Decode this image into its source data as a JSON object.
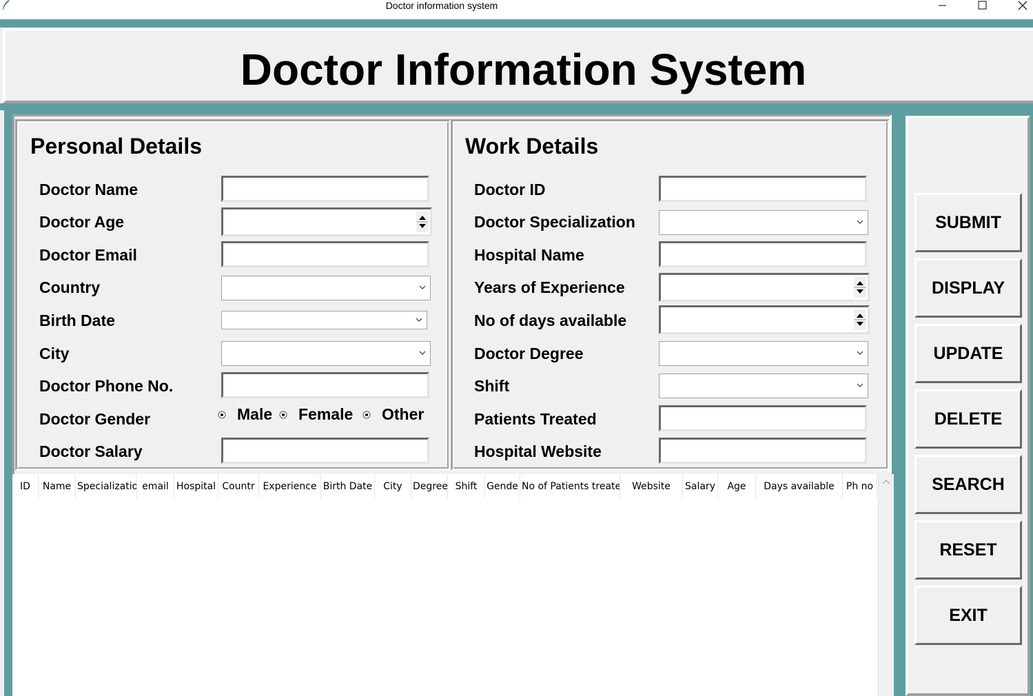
{
  "window": {
    "title": "Doctor information system",
    "controls": [
      "minimize",
      "maximize",
      "close"
    ]
  },
  "header": {
    "title": "Doctor Information System"
  },
  "personal": {
    "title": "Personal Details",
    "fields": [
      {
        "label": "Doctor Name",
        "type": "entry",
        "value": ""
      },
      {
        "label": "Doctor Age",
        "type": "spinbox",
        "value": ""
      },
      {
        "label": "Doctor Email",
        "type": "entry",
        "value": ""
      },
      {
        "label": "Country",
        "type": "combobox",
        "value": ""
      },
      {
        "label": "Birth Date",
        "type": "combobox",
        "value": ""
      },
      {
        "label": "City",
        "type": "combobox",
        "value": ""
      },
      {
        "label": "Doctor Phone No.",
        "type": "entry",
        "value": ""
      },
      {
        "label": "Doctor Gender",
        "type": "radio",
        "options": [
          "Male",
          "Female",
          "Other"
        ]
      },
      {
        "label": "Doctor Salary",
        "type": "entry",
        "value": ""
      }
    ]
  },
  "work": {
    "title": "Work Details",
    "fields": [
      {
        "label": "Doctor ID",
        "type": "entry",
        "value": ""
      },
      {
        "label": "Doctor Specialization",
        "type": "combobox",
        "value": ""
      },
      {
        "label": "Hospital Name",
        "type": "entry",
        "value": ""
      },
      {
        "label": "Years of Experience",
        "type": "spinbox",
        "value": ""
      },
      {
        "label": "No of days available",
        "type": "spinbox",
        "value": ""
      },
      {
        "label": "Doctor Degree",
        "type": "combobox",
        "value": ""
      },
      {
        "label": "Shift",
        "type": "combobox",
        "value": ""
      },
      {
        "label": "Patients Treated",
        "type": "entry",
        "value": ""
      },
      {
        "label": "Hospital Website",
        "type": "entry",
        "value": ""
      }
    ]
  },
  "table": {
    "columns": [
      "ID",
      "Name",
      "Specializatio",
      "email",
      "Hospital",
      "Countr",
      "Experience",
      "Birth Date",
      "City",
      "Degree",
      "Shift",
      "Gende",
      "No of Patients treate",
      "Website",
      "Salary",
      "Age",
      "Days available",
      "Ph no"
    ],
    "rows": []
  },
  "buttons": [
    "SUBMIT",
    "DISPLAY",
    "UPDATE",
    "DELETE",
    "SEARCH",
    "RESET",
    "EXIT"
  ],
  "colors": {
    "frame": "#5f9ea0",
    "background": "#f0f0f0"
  }
}
